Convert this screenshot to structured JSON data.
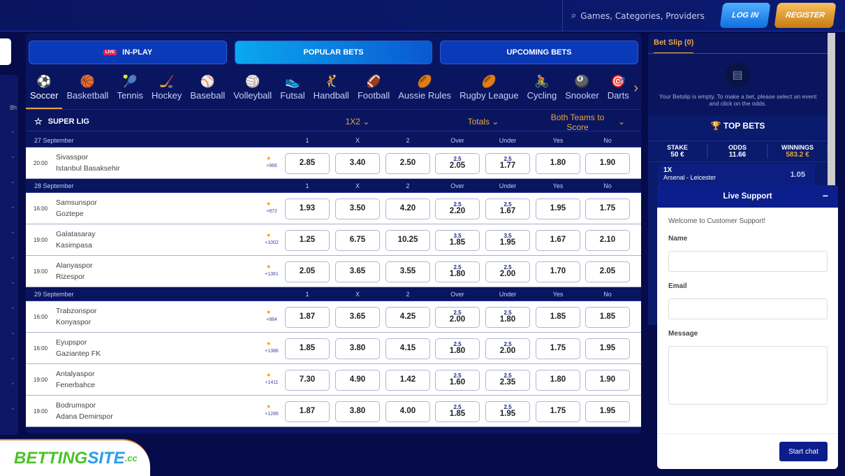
{
  "header": {
    "search_placeholder": "Games, Categories, Providers",
    "login": "LOG IN",
    "register": "REGISTER"
  },
  "tabs": [
    {
      "label": "IN-PLAY",
      "badge": "LIVE"
    },
    {
      "label": "POPULAR BETS"
    },
    {
      "label": "UPCOMING BETS"
    }
  ],
  "sports": [
    {
      "label": "Soccer",
      "icon": "⚽"
    },
    {
      "label": "Basketball",
      "icon": "🏀"
    },
    {
      "label": "Tennis",
      "icon": "🎾"
    },
    {
      "label": "Hockey",
      "icon": "🏒"
    },
    {
      "label": "Baseball",
      "icon": "⚾"
    },
    {
      "label": "Volleyball",
      "icon": "🏐"
    },
    {
      "label": "Futsal",
      "icon": "👟"
    },
    {
      "label": "Handball",
      "icon": "🤾"
    },
    {
      "label": "Football",
      "icon": "🏈"
    },
    {
      "label": "Aussie Rules",
      "icon": "🏉"
    },
    {
      "label": "Rugby League",
      "icon": "🏉"
    },
    {
      "label": "Cycling",
      "icon": "🚴"
    },
    {
      "label": "Snooker",
      "icon": "🎱"
    },
    {
      "label": "Darts",
      "icon": "🎯"
    }
  ],
  "league": {
    "name": "SUPER LIG",
    "markets": [
      "1X2",
      "Totals",
      "Both Teams to Score"
    ]
  },
  "col_headers": [
    "1",
    "X",
    "2",
    "Over",
    "Under",
    "Yes",
    "No"
  ],
  "days": [
    {
      "date": "27 September",
      "matches": [
        {
          "time": "20:00",
          "home": "Sivasspor",
          "away": "Istanbul Basaksehir",
          "more": "+966",
          "odds": [
            "2.85",
            "3.40",
            "2.50",
            [
              "2.5",
              "2.05"
            ],
            [
              "2.5",
              "1.77"
            ],
            "1.80",
            "1.90"
          ]
        }
      ]
    },
    {
      "date": "28 September",
      "matches": [
        {
          "time": "16:00",
          "home": "Samsunspor",
          "away": "Goztepe",
          "more": "+872",
          "odds": [
            "1.93",
            "3.50",
            "4.20",
            [
              "2.5",
              "2.20"
            ],
            [
              "2.5",
              "1.67"
            ],
            "1.95",
            "1.75"
          ]
        },
        {
          "time": "19:00",
          "home": "Galatasaray",
          "away": "Kasimpasa",
          "more": "+1002",
          "odds": [
            "1.25",
            "6.75",
            "10.25",
            [
              "3.5",
              "1.85"
            ],
            [
              "3.5",
              "1.95"
            ],
            "1.67",
            "2.10"
          ]
        },
        {
          "time": "19:00",
          "home": "Alanyaspor",
          "away": "Rizespor",
          "more": "+1361",
          "odds": [
            "2.05",
            "3.65",
            "3.55",
            [
              "2.5",
              "1.80"
            ],
            [
              "2.5",
              "2.00"
            ],
            "1.70",
            "2.05"
          ]
        }
      ]
    },
    {
      "date": "29 September",
      "matches": [
        {
          "time": "16:00",
          "home": "Trabzonspor",
          "away": "Konyaspor",
          "more": "+884",
          "odds": [
            "1.87",
            "3.65",
            "4.25",
            [
              "2.5",
              "2.00"
            ],
            [
              "2.5",
              "1.80"
            ],
            "1.85",
            "1.85"
          ]
        },
        {
          "time": "16:00",
          "home": "Eyupspor",
          "away": "Gaziantep FK",
          "more": "+1386",
          "odds": [
            "1.85",
            "3.80",
            "4.15",
            [
              "2.5",
              "1.80"
            ],
            [
              "2.5",
              "2.00"
            ],
            "1.75",
            "1.95"
          ]
        },
        {
          "time": "19:00",
          "home": "Antalyaspor",
          "away": "Fenerbahce",
          "more": "+1411",
          "odds": [
            "7.30",
            "4.90",
            "1.42",
            [
              "2.5",
              "1.60"
            ],
            [
              "2.5",
              "2.35"
            ],
            "1.80",
            "1.90"
          ]
        },
        {
          "time": "19:00",
          "home": "Bodrumspor",
          "away": "Adana Demirspor",
          "more": "+1286",
          "odds": [
            "1.87",
            "3.80",
            "4.00",
            [
              "2.5",
              "1.85"
            ],
            [
              "2.5",
              "1.95"
            ],
            "1.75",
            "1.95"
          ]
        }
      ]
    }
  ],
  "betslip": {
    "title": "Bet Slip (0)",
    "empty": "Your Betslip is empty. To make a bet, please select an event and click on the odds.",
    "top_bets_title": "TOP BETS",
    "stake_label": "STAKE",
    "stake": "50 €",
    "odds_label": "ODDS",
    "odds": "11.66",
    "win_label": "WINNINGS",
    "winnings": "583.2 €",
    "bet": {
      "market": "1X",
      "match": "Arsenal - Leicester",
      "odd": "1.05"
    }
  },
  "support": {
    "title": "Live Support",
    "welcome": "Welcome to Customer Support!",
    "name_label": "Name",
    "email_label": "Email",
    "message_label": "Message",
    "button": "Start chat"
  },
  "sidebar": {
    "partial_text": "8h"
  },
  "logo": {
    "text": "BettingSite.cc"
  },
  "colors": {
    "accent": "#e7a640",
    "background": "#060b4a",
    "primary": "#0c1d8c"
  }
}
